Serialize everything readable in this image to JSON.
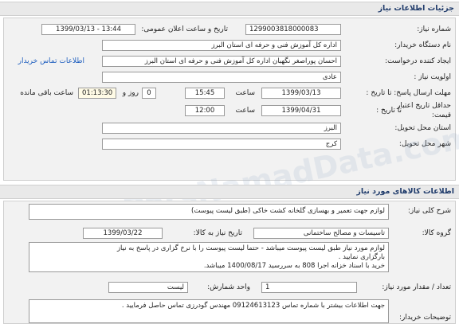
{
  "header": {
    "title": "جزئیات اطلاعات نیاز"
  },
  "details": {
    "need_number_label": "شماره نیاز:",
    "need_number": "1299003818000083",
    "announce_label": "تاریخ و ساعت اعلان عمومی:",
    "announce_value": "1399/03/13 - 13:44",
    "buyer_label": "نام دستگاه خریدار:",
    "buyer_value": "اداره کل آموزش فنی و حرفه ای استان البرز",
    "creator_label": "ایجاد کننده درخواست:",
    "creator_value": "احسان  پوراصغر نگهبان اداره کل آموزش فنی و حرفه ای استان البرز",
    "contact_link": "اطلاعات تماس خریدار",
    "priority_label": "اولویت نیاز :",
    "priority_value": "عادی",
    "deadline_label": "مهلت ارسال پاسخ: تا تاریخ :",
    "deadline_date": "1399/03/13",
    "time_label": "ساعت",
    "deadline_time": "15:45",
    "days_value": "0",
    "days_label": "روز و",
    "remaining_time": "01:13:30",
    "remaining_label": "ساعت باقی مانده",
    "validity_label": "حداقل تاریخ اعتبار",
    "validity_label2": "قیمت:",
    "validity_label3": "تا تاریخ :",
    "validity_date": "1399/04/31",
    "validity_time": "12:00",
    "province_label": "استان محل تحویل:",
    "province_value": "البرز",
    "city_label": "شهر محل تحویل:",
    "city_value": "کرج"
  },
  "goods": {
    "title": "اطلاعات کالاهای مورد نیاز",
    "summary_label": "شرح کلی نیاز:",
    "summary_value": "لوازم جهت تعمیر و بهسازی گلخانه کشت خاکی (طبق لیست پیوست)",
    "group_label": "گروه کالا:",
    "group_value": "تاسیسات و مصالح ساختمانی",
    "need_date_label": "تاریخ نیاز به کالا:",
    "need_date_value": "1399/03/22",
    "note_lines": [
      "لوازم مورد نیاز طبق لیست پیوست میباشد - حتما لیست پیوست را با نرخ گزاری در پاسخ به نیاز",
      "بارگزاری نمایید .",
      "خرید با اسناد خزانه اجرا 808 به سررسید 1400/08/17 میباشد."
    ],
    "count_label": "تعداد / مقدار مورد نیاز:",
    "count_value": "1",
    "unit_label": "واحد شمارش:",
    "unit_value": "لیست",
    "buyer_desc_label": "توضیحات خریدار:",
    "buyer_desc_value": "جهت اطلاعات بیشتر با شماره تماس 09124613123 مهندس گودرزی تماس حاصل فرمایید ."
  },
  "watermark": "ParsNamadData.com"
}
